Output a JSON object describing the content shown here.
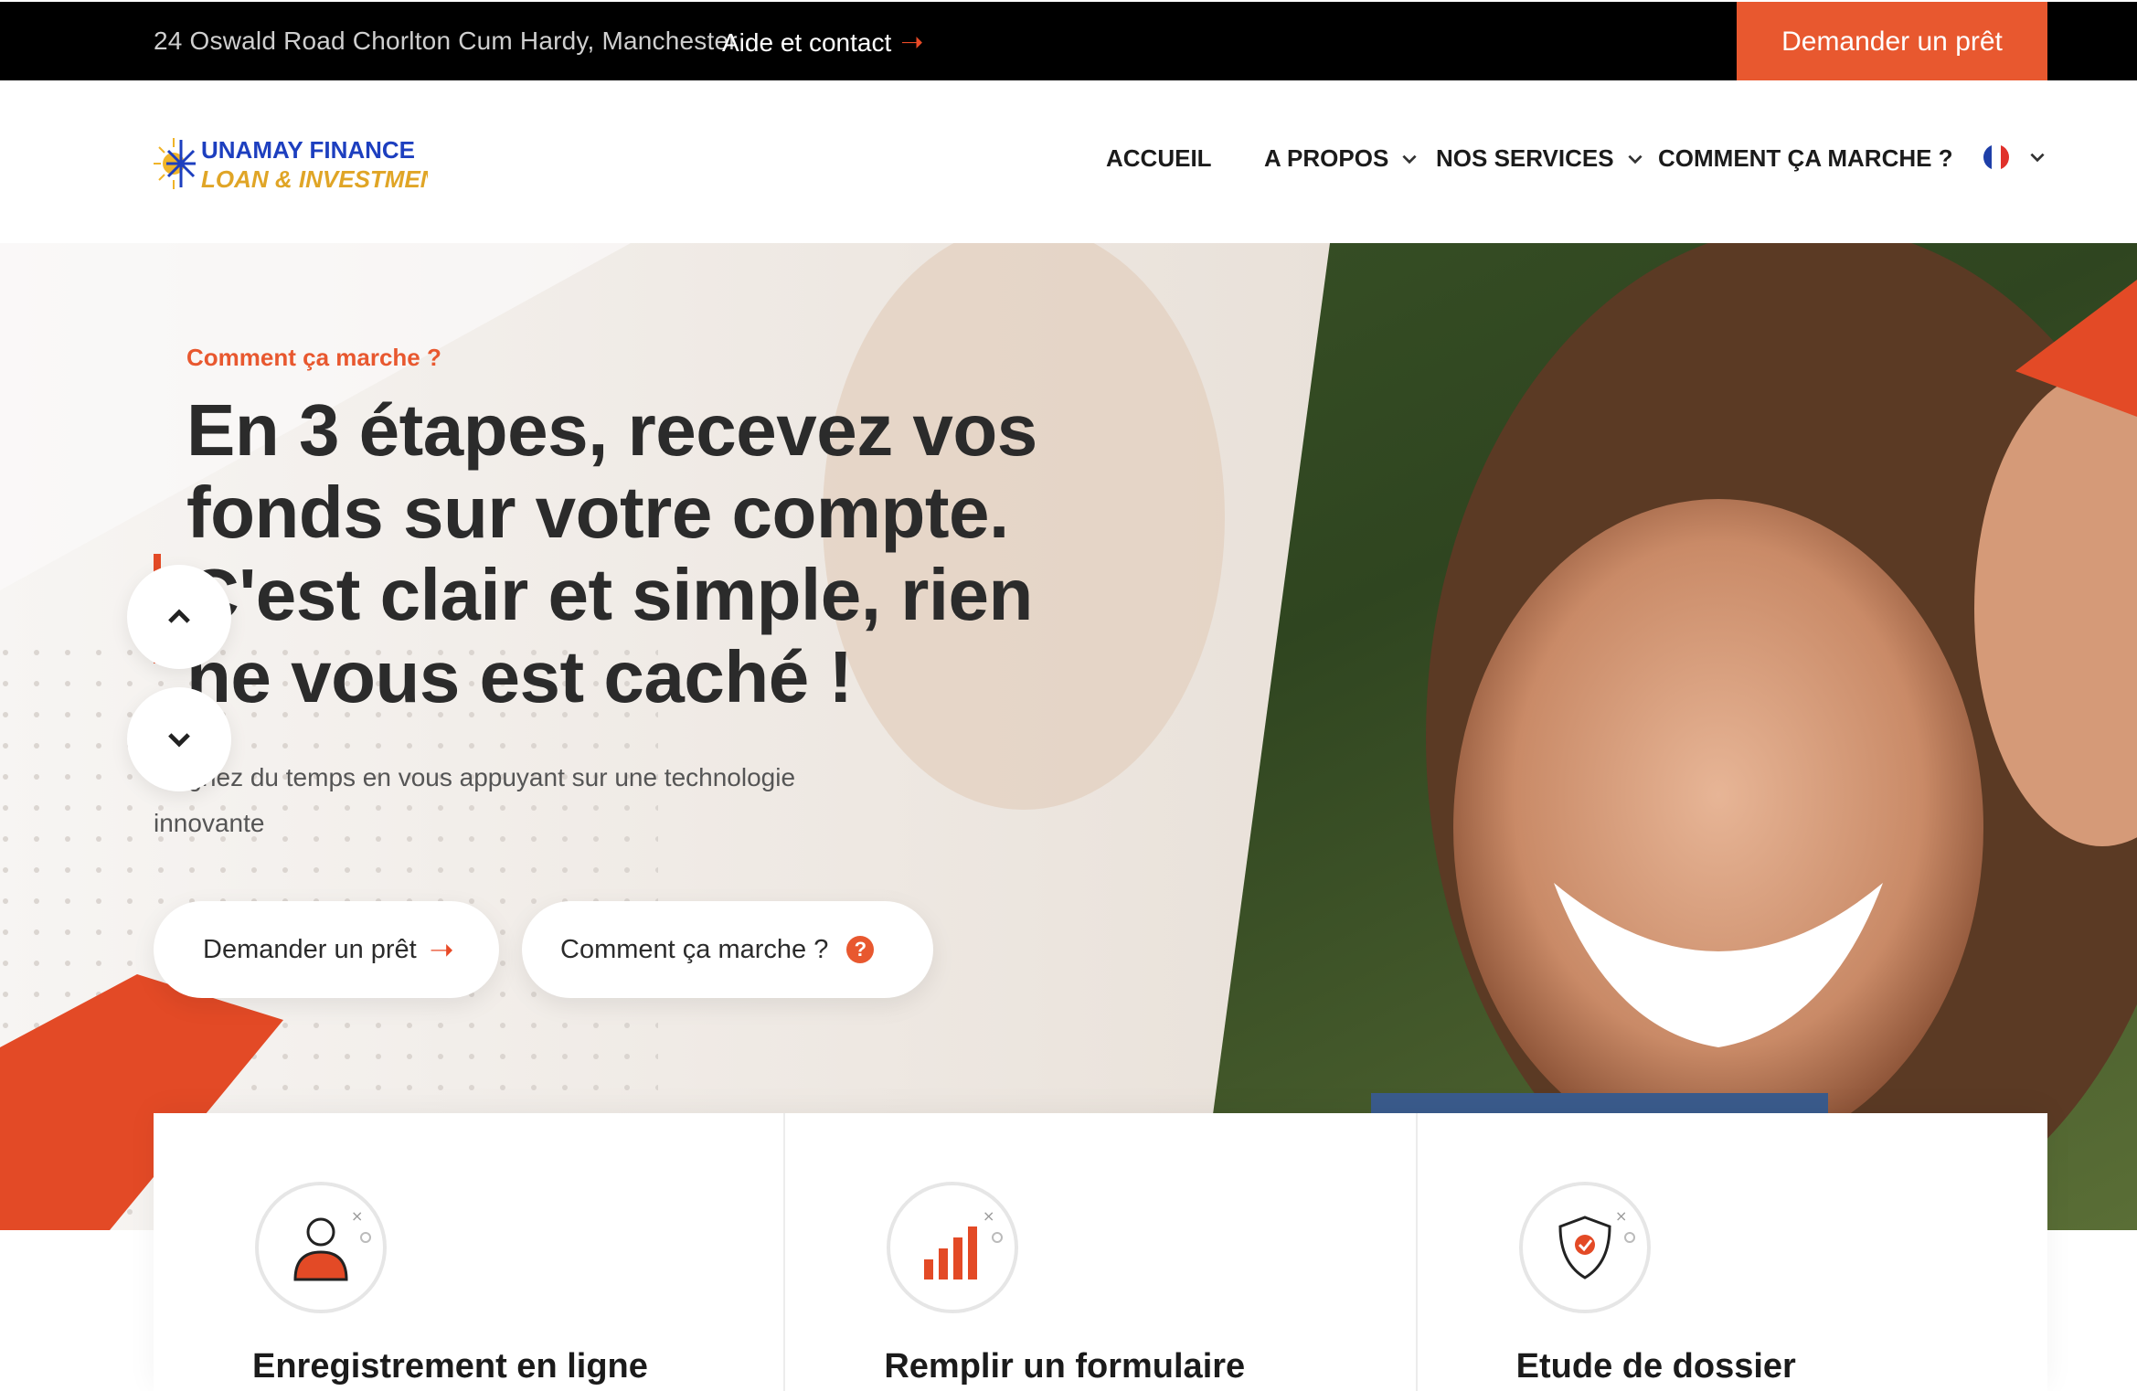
{
  "topbar": {
    "address": "24 Oswald Road Chorlton Cum Hardy, Manchester",
    "help_label": "Aide et contact",
    "cta_label": "Demander un prêt"
  },
  "header": {
    "logo_line1": "UNAMAY FINANCE",
    "logo_line2": "LOAN & INVESTMENT",
    "nav": {
      "accueil": "ACCUEIL",
      "apropos": "A PROPOS",
      "services": "NOS SERVICES",
      "comment": "COMMENT ÇA MARCHE ?"
    },
    "language": "fr-flag-icon"
  },
  "hero": {
    "eyebrow": "Comment ça marche ?",
    "headline": "En 3 étapes, recevez vos fonds sur votre compte. C'est clair et simple, rien ne vous est caché !",
    "subtitle": "Gagnez du temps en vous appuyant sur une technologie innovante",
    "btn_loan": "Demander un prêt",
    "btn_how": "Comment ça marche ?",
    "accent_color": "#e8582f"
  },
  "steps": [
    {
      "title": "Enregistrement en ligne",
      "icon": "user-icon"
    },
    {
      "title": "Remplir un formulaire",
      "icon": "bar-chart-icon"
    },
    {
      "title": "Etude de dossier",
      "icon": "shield-check-icon"
    }
  ]
}
